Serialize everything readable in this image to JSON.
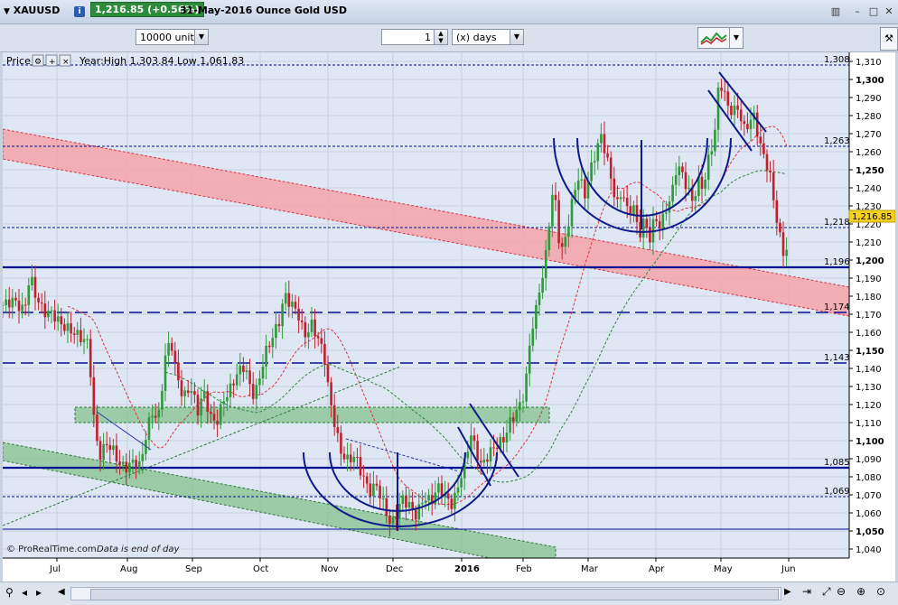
{
  "window": {
    "symbol": "XAUUSD",
    "price_badge": "1,216.85 (+0.56%)",
    "date_title": "31-May-2016  Ounce Gold USD"
  },
  "toolbar": {
    "units_value": "10000 units",
    "period_value": "1",
    "period_unit": "(x) days"
  },
  "legend": {
    "label": "Price",
    "range_text": "Year:High 1,303.84 Low 1,061.83"
  },
  "watermark": {
    "text": "© ProRealTime.com",
    "note": "Data is end of day"
  },
  "colors": {
    "up_candle": "#2f9a39",
    "down_candle": "#c0202c",
    "support_line": "#00128f",
    "red_channel": "#f08a90",
    "green_zone": "#5fae69",
    "price_tag_bg": "#f6d21c"
  },
  "chart_data": {
    "type": "candlestick",
    "y_axis": {
      "min": 1035,
      "max": 1315,
      "tick_step": 10,
      "bold_every": 50,
      "ticks": [
        "1,040",
        "1,050",
        "1,060",
        "1,070",
        "1,080",
        "1,090",
        "1,100",
        "1,110",
        "1,120",
        "1,130",
        "1,140",
        "1,150",
        "1,160",
        "1,170",
        "1,180",
        "1,190",
        "1,200",
        "1,210",
        "1,220",
        "1,230",
        "1,240",
        "1,250",
        "1,260",
        "1,270",
        "1,280",
        "1,290",
        "1,300",
        "1,310"
      ]
    },
    "x_axis": {
      "labels": [
        {
          "label": "Jul",
          "x": 60
        },
        {
          "label": "Aug",
          "x": 138
        },
        {
          "label": "Sep",
          "x": 210
        },
        {
          "label": "Oct",
          "x": 285
        },
        {
          "label": "Nov",
          "x": 360
        },
        {
          "label": "Dec",
          "x": 432
        },
        {
          "label": "2016",
          "x": 508
        },
        {
          "label": "Feb",
          "x": 576
        },
        {
          "label": "Mar",
          "x": 648
        },
        {
          "label": "Apr",
          "x": 723
        },
        {
          "label": "May",
          "x": 795
        },
        {
          "label": "Jun",
          "x": 870
        }
      ]
    },
    "last_price": "1,216.85",
    "level_labels": [
      "1,308",
      "1,263",
      "1,218",
      "1,196",
      "1,174",
      "1,143",
      "1,085",
      "1,069"
    ],
    "series": [
      {
        "name": "XAUUSD daily close (approx.)",
        "anchors": [
          [
            0,
            1175
          ],
          [
            12,
            1180
          ],
          [
            24,
            1175
          ],
          [
            30,
            1196
          ],
          [
            36,
            1185
          ],
          [
            45,
            1175
          ],
          [
            55,
            1173
          ],
          [
            65,
            1165
          ],
          [
            75,
            1160
          ],
          [
            85,
            1155
          ],
          [
            95,
            1150
          ],
          [
            102,
            1100
          ],
          [
            108,
            1088
          ],
          [
            115,
            1095
          ],
          [
            122,
            1092
          ],
          [
            130,
            1085
          ],
          [
            138,
            1085
          ],
          [
            145,
            1090
          ],
          [
            152,
            1088
          ],
          [
            160,
            1110
          ],
          [
            166,
            1120
          ],
          [
            172,
            1115
          ],
          [
            180,
            1150
          ],
          [
            186,
            1160
          ],
          [
            192,
            1140
          ],
          [
            200,
            1125
          ],
          [
            208,
            1130
          ],
          [
            216,
            1115
          ],
          [
            222,
            1125
          ],
          [
            230,
            1110
          ],
          [
            236,
            1105
          ],
          [
            244,
            1118
          ],
          [
            252,
            1125
          ],
          [
            260,
            1135
          ],
          [
            268,
            1140
          ],
          [
            276,
            1125
          ],
          [
            282,
            1130
          ],
          [
            290,
            1150
          ],
          [
            298,
            1160
          ],
          [
            306,
            1170
          ],
          [
            312,
            1185
          ],
          [
            318,
            1180
          ],
          [
            326,
            1175
          ],
          [
            334,
            1160
          ],
          [
            342,
            1165
          ],
          [
            350,
            1155
          ],
          [
            356,
            1145
          ],
          [
            362,
            1120
          ],
          [
            368,
            1105
          ],
          [
            374,
            1090
          ],
          [
            382,
            1085
          ],
          [
            390,
            1088
          ],
          [
            398,
            1078
          ],
          [
            406,
            1070
          ],
          [
            414,
            1075
          ],
          [
            422,
            1065
          ],
          [
            430,
            1055
          ],
          [
            436,
            1063
          ],
          [
            442,
            1072
          ],
          [
            450,
            1068
          ],
          [
            458,
            1062
          ],
          [
            466,
            1072
          ],
          [
            474,
            1068
          ],
          [
            482,
            1075
          ],
          [
            490,
            1068
          ],
          [
            498,
            1062
          ],
          [
            506,
            1075
          ],
          [
            512,
            1085
          ],
          [
            518,
            1100
          ],
          [
            524,
            1090
          ],
          [
            530,
            1082
          ],
          [
            538,
            1090
          ],
          [
            546,
            1096
          ],
          [
            554,
            1100
          ],
          [
            562,
            1112
          ],
          [
            568,
            1118
          ],
          [
            575,
            1125
          ],
          [
            580,
            1140
          ],
          [
            585,
            1165
          ],
          [
            590,
            1175
          ],
          [
            595,
            1190
          ],
          [
            600,
            1200
          ],
          [
            605,
            1225
          ],
          [
            610,
            1245
          ],
          [
            615,
            1215
          ],
          [
            620,
            1205
          ],
          [
            626,
            1220
          ],
          [
            632,
            1235
          ],
          [
            638,
            1245
          ],
          [
            644,
            1232
          ],
          [
            650,
            1245
          ],
          [
            656,
            1255
          ],
          [
            662,
            1265
          ],
          [
            668,
            1255
          ],
          [
            674,
            1240
          ],
          [
            680,
            1228
          ],
          [
            686,
            1238
          ],
          [
            692,
            1225
          ],
          [
            698,
            1232
          ],
          [
            704,
            1215
          ],
          [
            710,
            1225
          ],
          [
            716,
            1215
          ],
          [
            722,
            1228
          ],
          [
            728,
            1222
          ],
          [
            734,
            1232
          ],
          [
            740,
            1238
          ],
          [
            746,
            1255
          ],
          [
            752,
            1250
          ],
          [
            758,
            1240
          ],
          [
            764,
            1232
          ],
          [
            770,
            1242
          ],
          [
            776,
            1238
          ],
          [
            782,
            1255
          ],
          [
            788,
            1265
          ],
          [
            792,
            1290
          ],
          [
            796,
            1293
          ],
          [
            802,
            1282
          ],
          [
            808,
            1278
          ],
          [
            814,
            1282
          ],
          [
            820,
            1270
          ],
          [
            826,
            1275
          ],
          [
            832,
            1280
          ],
          [
            838,
            1265
          ],
          [
            844,
            1258
          ],
          [
            850,
            1248
          ],
          [
            856,
            1228
          ],
          [
            862,
            1212
          ],
          [
            866,
            1205
          ],
          [
            870,
            1217
          ]
        ]
      }
    ],
    "moving_averages": [
      {
        "name": "red dashed MA"
      },
      {
        "name": "green dashed MA"
      }
    ],
    "horizontal_levels": [
      {
        "label": "1,308",
        "value": 1308,
        "style": "dashed"
      },
      {
        "label": "1,263",
        "value": 1263,
        "style": "dashed"
      },
      {
        "label": "1,218",
        "value": 1218,
        "style": "dashed"
      },
      {
        "label": "1,196",
        "value": 1196,
        "style": "solid-thick"
      },
      {
        "label": "1,174",
        "value": 1171,
        "style": "long-dash"
      },
      {
        "label": "1,143",
        "value": 1143,
        "style": "long-dash"
      },
      {
        "label": "1,085",
        "value": 1085,
        "style": "solid-thick"
      },
      {
        "label": "1,069",
        "value": 1069,
        "style": "dashed"
      },
      {
        "label": "",
        "value": 1051,
        "style": "solid-thin"
      }
    ]
  }
}
